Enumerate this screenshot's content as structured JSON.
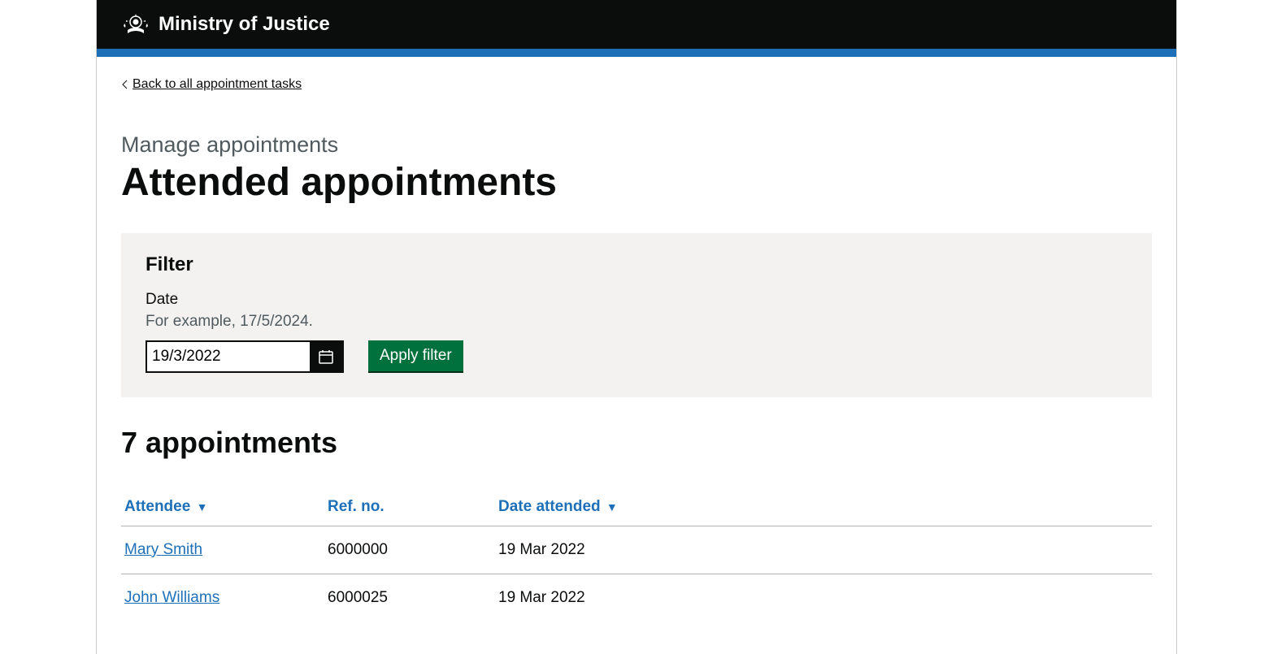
{
  "header": {
    "service_name": "Ministry of Justice"
  },
  "back_link": {
    "label": "Back to all appointment tasks"
  },
  "caption": "Manage appointments",
  "heading": "Attended appointments",
  "filter": {
    "heading": "Filter",
    "date_label": "Date",
    "date_hint": "For example, 17/5/2024.",
    "date_value": "19/3/2022",
    "apply_label": "Apply filter"
  },
  "results": {
    "count_heading": "7 appointments",
    "columns": {
      "attendee": "Attendee",
      "ref": "Ref. no.",
      "date": "Date attended"
    },
    "rows": [
      {
        "attendee": "Mary Smith",
        "ref": "6000000",
        "date": "19 Mar 2022"
      },
      {
        "attendee": "John Williams",
        "ref": "6000025",
        "date": "19 Mar 2022"
      }
    ]
  }
}
